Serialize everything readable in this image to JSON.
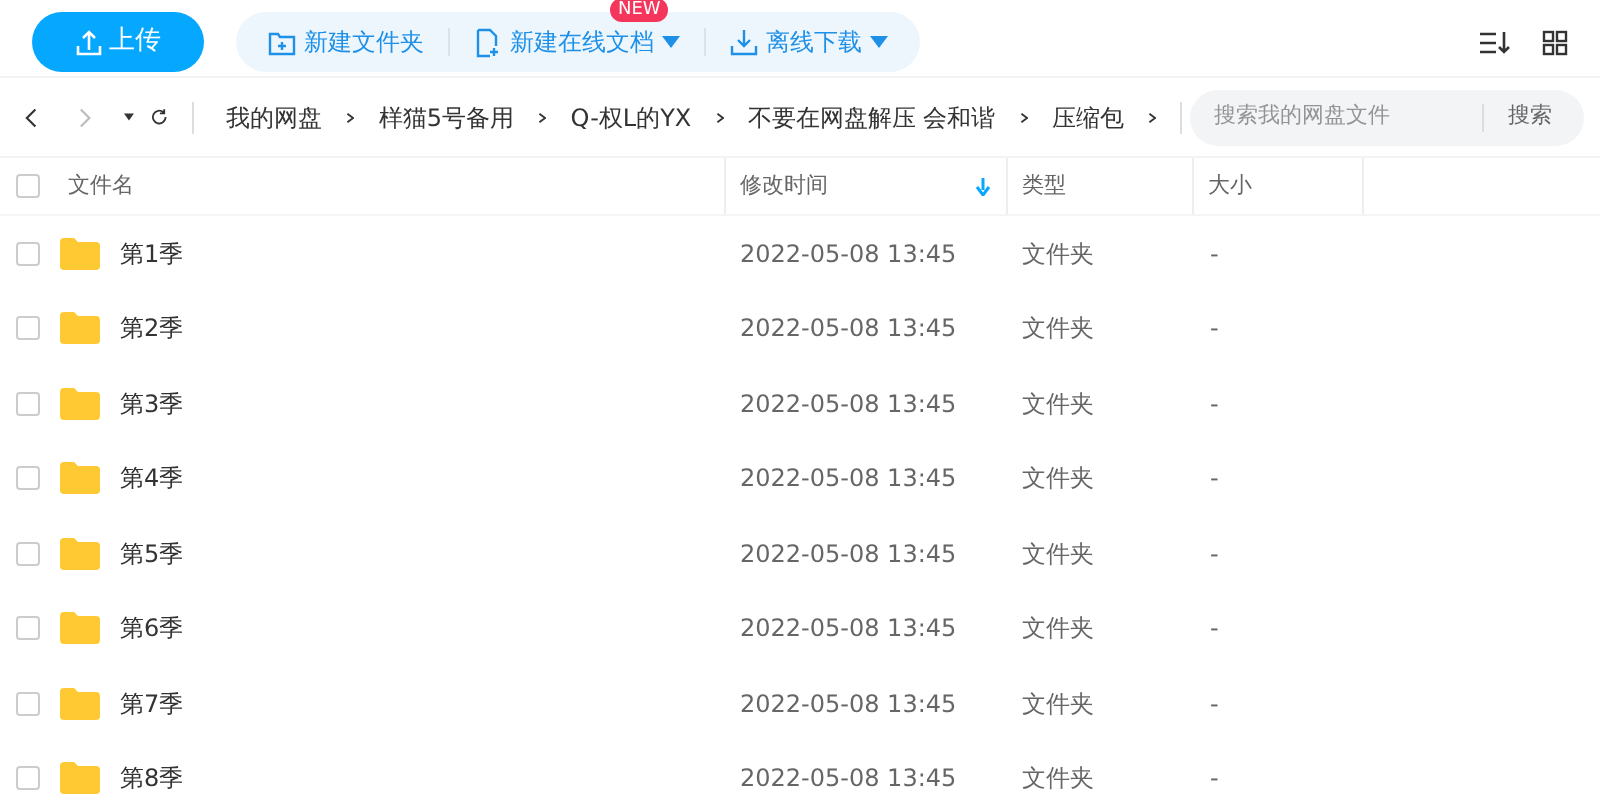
{
  "toolbar": {
    "upload": "上传",
    "actions": [
      {
        "label": "新建文件夹",
        "kind": "folder",
        "dropdown": false
      },
      {
        "label": "新建在线文档",
        "kind": "doc",
        "dropdown": true,
        "badge": "NEW"
      },
      {
        "label": "离线下载",
        "kind": "download",
        "dropdown": true
      }
    ]
  },
  "breadcrumb": [
    "我的网盘",
    "样猫5号备用",
    "Q-权L的YX",
    "不要在网盘解压 会和谐",
    "压缩包"
  ],
  "search": {
    "placeholder": "搜索我的网盘文件",
    "button": "搜索"
  },
  "table": {
    "select_all_checked": false,
    "columns": [
      {
        "label": "文件名",
        "sorted": false
      },
      {
        "label": "修改时间",
        "sorted": true
      },
      {
        "label": "类型",
        "sorted": false
      },
      {
        "label": "大小",
        "sorted": false
      }
    ],
    "rows": [
      {
        "name": "第1季",
        "modified": "2022-05-08 13:45",
        "type": "文件夹",
        "size": "-",
        "checked": false
      },
      {
        "name": "第2季",
        "modified": "2022-05-08 13:45",
        "type": "文件夹",
        "size": "-",
        "checked": false
      },
      {
        "name": "第3季",
        "modified": "2022-05-08 13:45",
        "type": "文件夹",
        "size": "-",
        "checked": false
      },
      {
        "name": "第4季",
        "modified": "2022-05-08 13:45",
        "type": "文件夹",
        "size": "-",
        "checked": false
      },
      {
        "name": "第5季",
        "modified": "2022-05-08 13:45",
        "type": "文件夹",
        "size": "-",
        "checked": false
      },
      {
        "name": "第6季",
        "modified": "2022-05-08 13:45",
        "type": "文件夹",
        "size": "-",
        "checked": false
      },
      {
        "name": "第7季",
        "modified": "2022-05-08 13:45",
        "type": "文件夹",
        "size": "-",
        "checked": false
      },
      {
        "name": "第8季",
        "modified": "2022-05-08 13:45",
        "type": "文件夹",
        "size": "-",
        "checked": false
      }
    ]
  }
}
